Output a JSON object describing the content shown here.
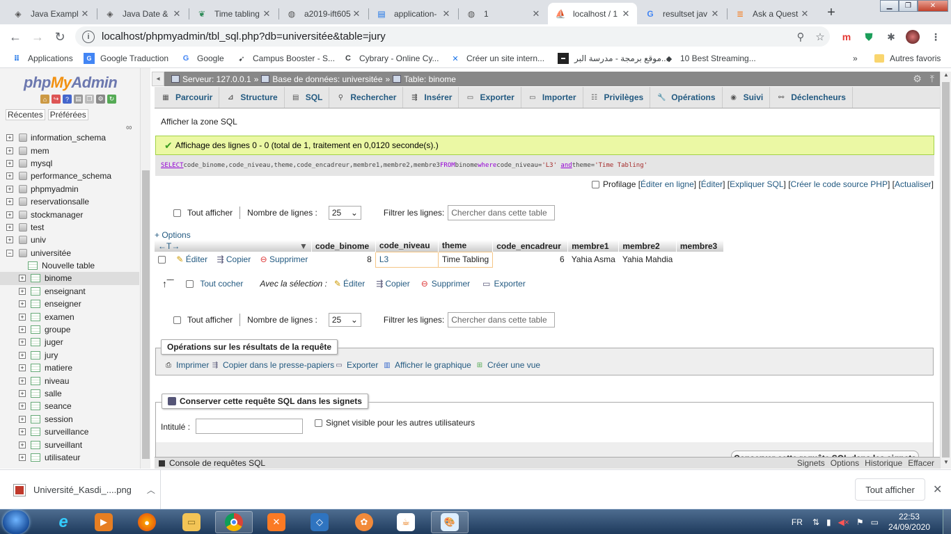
{
  "browser": {
    "tabs": [
      {
        "title": "Java Exampl",
        "icon": "diamond-icon"
      },
      {
        "title": "Java Date &",
        "icon": "diamond-icon"
      },
      {
        "title": "Time tabling",
        "icon": "leaf-icon"
      },
      {
        "title": "a2019-ift605",
        "icon": "globe-icon"
      },
      {
        "title": "application-",
        "icon": "document-icon"
      },
      {
        "title": "1",
        "icon": "globe-icon"
      },
      {
        "title": "localhost / 1",
        "icon": "pma-icon"
      },
      {
        "title": "resultset jav",
        "icon": "google-icon"
      },
      {
        "title": "Ask a Quest",
        "icon": "stackoverflow-icon"
      }
    ],
    "url": "localhost/phpmyadmin/tbl_sql.php?db=universitée&table=jury",
    "bookmarks": [
      "Applications",
      "Google Traduction",
      "Google",
      "Campus Booster - S...",
      "Cybrary - Online Cy...",
      "Créer un site intern...",
      "موقع برمجة - مدرسة البر...",
      "10 Best Streaming..."
    ],
    "bookmarks_more": "»",
    "other_bookmarks": "Autres favoris"
  },
  "pma": {
    "logo": {
      "php": "php",
      "my": "My",
      "admin": "Admin"
    },
    "nav_links": [
      "Récentes",
      "Préférées"
    ],
    "link_chain": "∞",
    "databases": [
      "information_schema",
      "mem",
      "mysql",
      "performance_schema",
      "phpmyadmin",
      "reservationsalle",
      "stockmanager",
      "test",
      "univ",
      "universitée"
    ],
    "new_table": "Nouvelle table",
    "tables": [
      "binome",
      "enseignant",
      "enseigner",
      "examen",
      "groupe",
      "juger",
      "jury",
      "matiere",
      "niveau",
      "salle",
      "seance",
      "session",
      "surveillance",
      "surveillant",
      "utilisateur"
    ],
    "selected_table": "binome",
    "breadcrumb": {
      "server": "Serveur: 127.0.0.1",
      "database": "Base de données: universitée",
      "table": "Table: binome",
      "sep": "»"
    },
    "menu_tabs": [
      "Parcourir",
      "Structure",
      "SQL",
      "Rechercher",
      "Insérer",
      "Exporter",
      "Importer",
      "Privilèges",
      "Opérations",
      "Suivi",
      "Déclencheurs"
    ],
    "show_sql_area": "Afficher la zone SQL",
    "success_message": "Affichage des lignes 0 - 0 (total de 1, traitement en 0,0120 seconde(s).)",
    "sql": {
      "kw_select": "SELECT",
      "cols": " code_binome,code_niveau,theme,code_encadreur,membre1,membre2,membre3 ",
      "kw_from": "FROM",
      "rest1": " binome ",
      "kw_where": "where",
      "rest2": " code_niveau=",
      "val1": "'L3'",
      "kw_and": "and",
      "rest3": " theme=",
      "val2": "'Time Tabling'"
    },
    "profiling": {
      "label": "Profilage",
      "links": [
        "Éditer en ligne",
        "Éditer",
        "Expliquer SQL",
        "Créer le code source PHP",
        "Actualiser"
      ]
    },
    "controls": {
      "show_all": "Tout afficher",
      "row_count_label": "Nombre de lignes :",
      "row_count_value": "25",
      "filter_label": "Filtrer les lignes:",
      "filter_placeholder": "Chercher dans cette table"
    },
    "options_link": "+ Options",
    "columns": [
      "code_binome",
      "code_niveau",
      "theme",
      "code_encadreur",
      "membre1",
      "membre2",
      "membre3"
    ],
    "row_actions": {
      "edit": "Éditer",
      "copy": "Copier",
      "delete": "Supprimer"
    },
    "rows": [
      {
        "code_binome": "8",
        "code_niveau": "L3",
        "theme": "Time Tabling",
        "code_encadreur": "6",
        "membre1": "Yahia Asma",
        "membre2": "Yahia Mahdia",
        "membre3": ""
      }
    ],
    "with_selection": {
      "check_all": "Tout cocher",
      "label": "Avec la sélection :",
      "edit": "Éditer",
      "copy": "Copier",
      "delete": "Supprimer",
      "export": "Exporter"
    },
    "query_ops": {
      "legend": "Opérations sur les résultats de la requête",
      "items": [
        "Imprimer",
        "Copier dans le presse-papiers",
        "Exporter",
        "Afficher le graphique",
        "Créer une vue"
      ]
    },
    "bookmark": {
      "legend": "Conserver cette requête SQL dans les signets",
      "label_field": "Intitulé :",
      "shared_label": "Signet visible pour les autres utilisateurs",
      "submit": "Conserver cette requête SQL dans les signets"
    },
    "console": {
      "label": "Console de requêtes SQL",
      "links": [
        "Signets",
        "Options",
        "Historique",
        "Effacer"
      ]
    }
  },
  "download": {
    "file": "Université_Kasdi_....png",
    "show_all": "Tout afficher"
  },
  "taskbar": {
    "lang": "FR",
    "time": "22:53",
    "date": "24/09/2020"
  },
  "colors": {
    "pma_link": "#235a81",
    "success_bg": "#ebf8a4",
    "highlight_col": "#ffe6b3"
  }
}
